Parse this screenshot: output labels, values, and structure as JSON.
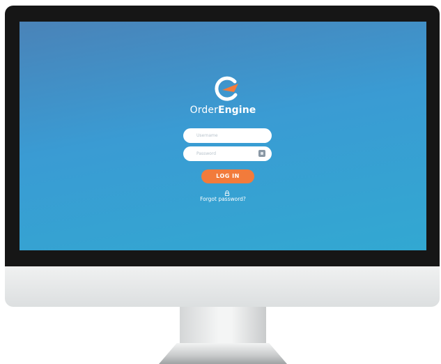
{
  "brand": {
    "name_part1": "Order",
    "name_part2": "Engine"
  },
  "login": {
    "username_placeholder": "Username",
    "password_placeholder": "Password",
    "login_button": "LOG IN",
    "forgot_password": "Forgot password?"
  },
  "colors": {
    "accent": "#f27b3b",
    "screen_top": "#4a83b8",
    "screen_bottom": "#32a8d2"
  },
  "icons": [
    "order-engine-logo-icon",
    "password-key-icon",
    "lock-icon"
  ]
}
